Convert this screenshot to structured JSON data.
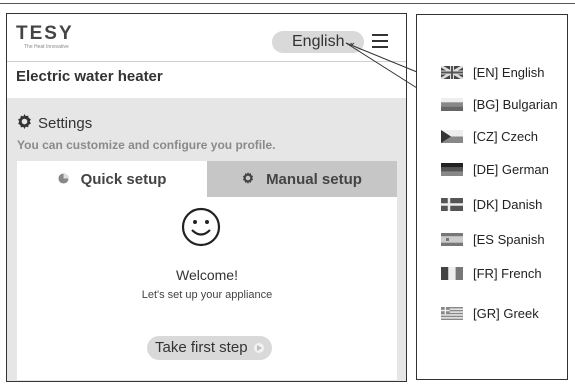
{
  "app": {
    "logo": "TESY",
    "logo_sub": "The Heat Innovative",
    "language_button": "English",
    "device_title": "Electric water heater"
  },
  "settings": {
    "title": "Settings",
    "description": "You can customize and configure you profile.",
    "tabs": [
      {
        "label": "Quick setup",
        "icon": "clock-icon",
        "active": true
      },
      {
        "label": "Manual setup",
        "icon": "gear-icon",
        "active": false
      }
    ]
  },
  "welcome": {
    "heading": "Welcome!",
    "subtext": "Let's set up your appliance",
    "button": "Take first step"
  },
  "languages": [
    {
      "label": "[EN] English",
      "flag": "uk-flag-icon"
    },
    {
      "label": "[BG] Bulgarian",
      "flag": "bulgaria-flag-icon"
    },
    {
      "label": "[CZ] Czech",
      "flag": "czech-flag-icon"
    },
    {
      "label": "[DE] German",
      "flag": "germany-flag-icon"
    },
    {
      "label": "[DK] Danish",
      "flag": "denmark-flag-icon"
    },
    {
      "label": "[ES Spanish",
      "flag": "spain-flag-icon"
    },
    {
      "label": "[FR] French",
      "flag": "france-flag-icon"
    },
    {
      "label": "[GR] Greek",
      "flag": "greece-flag-icon"
    }
  ]
}
